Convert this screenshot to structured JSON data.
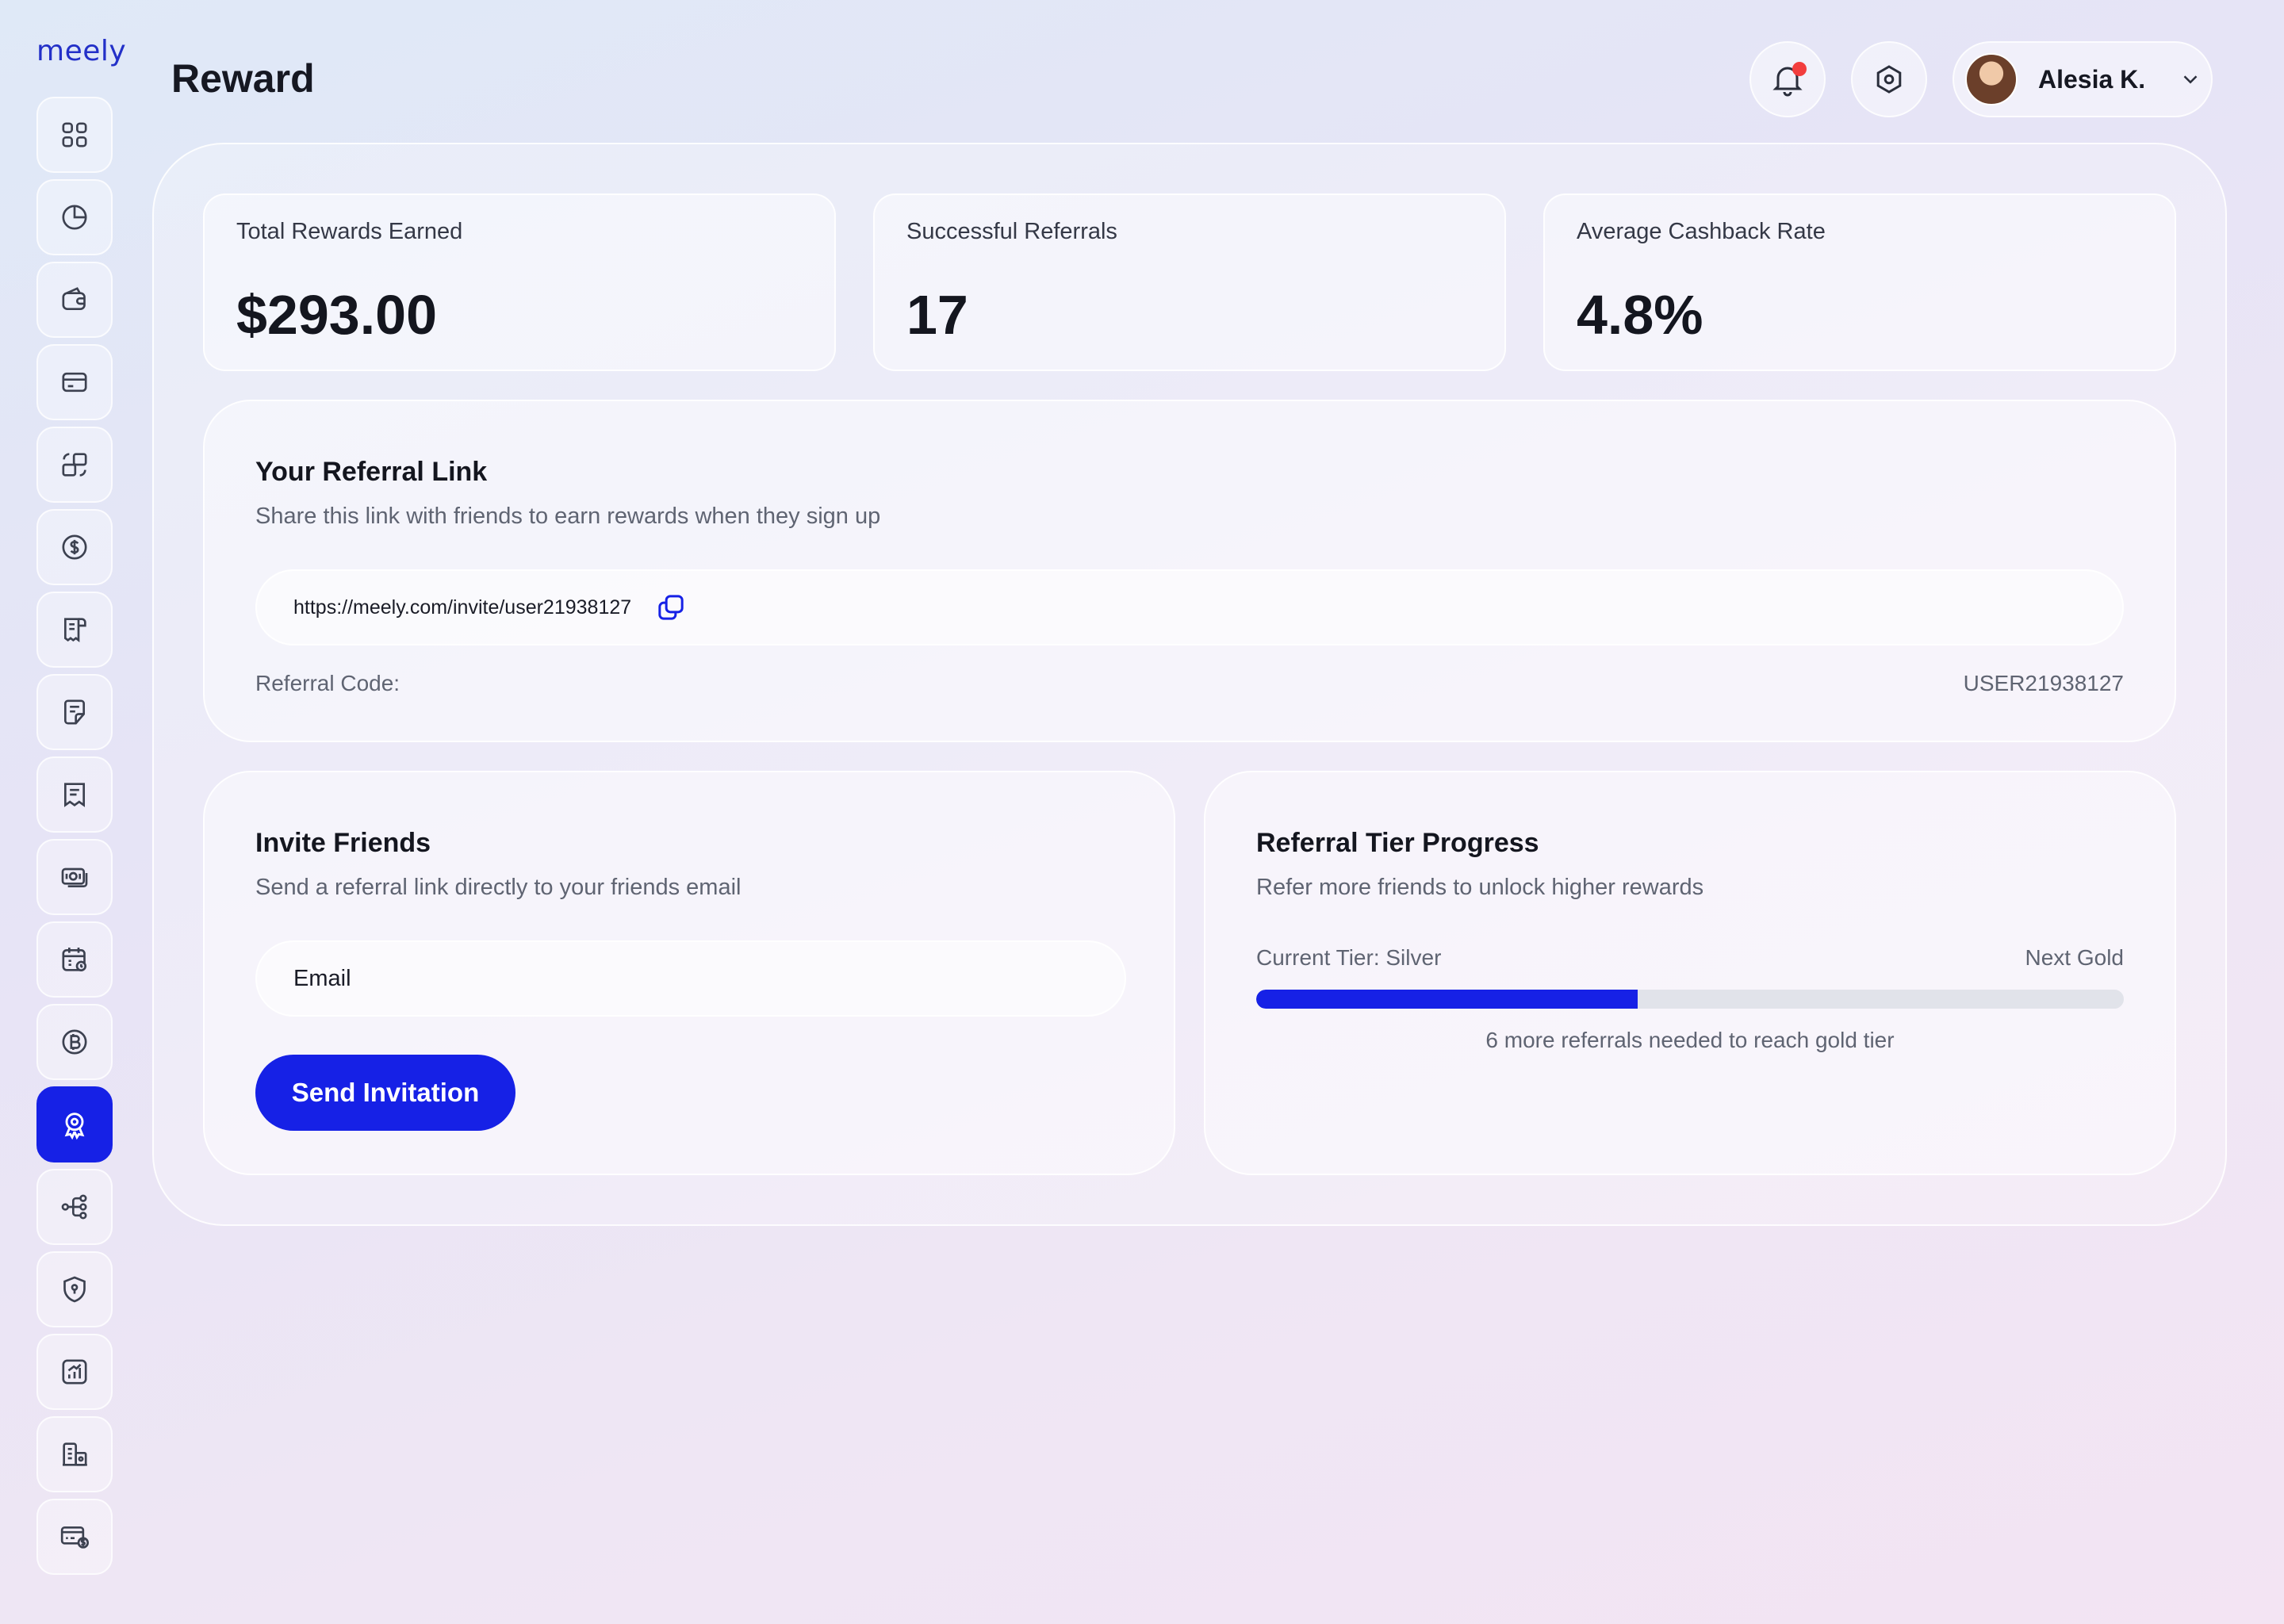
{
  "app": {
    "logo": "meely"
  },
  "header": {
    "title": "Reward",
    "user_name": "Alesia K."
  },
  "sidebar": {
    "items": [
      {
        "icon": "dashboard-grid-icon"
      },
      {
        "icon": "pie-chart-icon"
      },
      {
        "icon": "wallet-icon"
      },
      {
        "icon": "credit-card-icon"
      },
      {
        "icon": "transfer-icon"
      },
      {
        "icon": "dollar-circle-icon"
      },
      {
        "icon": "invoice-icon"
      },
      {
        "icon": "document-icon"
      },
      {
        "icon": "receipt-icon"
      },
      {
        "icon": "cash-icon"
      },
      {
        "icon": "calendar-icon"
      },
      {
        "icon": "bitcoin-icon"
      },
      {
        "icon": "reward-badge-icon",
        "active": true
      },
      {
        "icon": "flow-icon"
      },
      {
        "icon": "security-shield-icon"
      },
      {
        "icon": "analytics-icon"
      },
      {
        "icon": "company-icon"
      },
      {
        "icon": "payment-card-icon"
      }
    ]
  },
  "stats": [
    {
      "label": "Total Rewards Earned",
      "value": "$293.00"
    },
    {
      "label": "Successful Referrals",
      "value": "17"
    },
    {
      "label": "Average Cashback Rate",
      "value": "4.8%"
    }
  ],
  "referral": {
    "title": "Your Referral Link",
    "subtitle": "Share this link with friends to earn rewards when they sign up",
    "link": "https://meely.com/invite/user21938127",
    "code_label": "Referral Code:",
    "code_value": "USER21938127"
  },
  "invite": {
    "title": "Invite Friends",
    "subtitle": "Send a referral link directly to your friends email",
    "email_placeholder": "Email",
    "button_label": "Send Invitation"
  },
  "tier": {
    "title": "Referral Tier Progress",
    "subtitle": "Refer more friends to unlock higher rewards",
    "current_label": "Current Tier: Silver",
    "next_label": "Next Gold",
    "progress_percent": 44,
    "note": "6 more referrals needed to reach gold tier"
  },
  "colors": {
    "accent": "#1621e6",
    "notification_dot": "#f23d3d",
    "track": "#e1e3ea"
  }
}
